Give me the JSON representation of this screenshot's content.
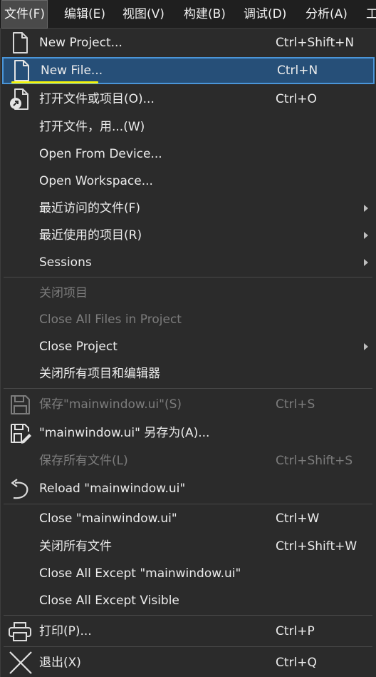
{
  "menubar": {
    "items": [
      {
        "label": "文件(F)"
      },
      {
        "label": "编辑(E)"
      },
      {
        "label": "视图(V)"
      },
      {
        "label": "构建(B)"
      },
      {
        "label": "调试(D)"
      },
      {
        "label": "分析(A)"
      },
      {
        "label": "工"
      }
    ]
  },
  "file_menu": {
    "items": {
      "new_project": {
        "label": "New Project...",
        "shortcut": "Ctrl+Shift+N",
        "icon": "new-project-icon"
      },
      "new_file": {
        "label": "New File...",
        "shortcut": "Ctrl+N",
        "icon": "new-file-icon"
      },
      "open_file_or_project": {
        "label": "打开文件或项目(O)...",
        "shortcut": "Ctrl+O",
        "icon": "open-file-icon"
      },
      "open_with": {
        "label": "打开文件，用...(W)"
      },
      "open_from_device": {
        "label": "Open From Device..."
      },
      "open_workspace": {
        "label": "Open Workspace..."
      },
      "recent_files": {
        "label": "最近访问的文件(F)"
      },
      "recent_projects": {
        "label": "最近使用的项目(R)"
      },
      "sessions": {
        "label": "Sessions"
      },
      "close_project_cn": {
        "label": "关闭项目"
      },
      "close_all_files_in_project": {
        "label": "Close All Files in Project"
      },
      "close_project": {
        "label": "Close Project"
      },
      "close_all_projects_editors": {
        "label": "关闭所有项目和编辑器"
      },
      "save": {
        "label": "保存\"mainwindow.ui\"(S)",
        "shortcut": "Ctrl+S",
        "icon": "save-icon"
      },
      "save_as": {
        "label": "\"mainwindow.ui\" 另存为(A)...",
        "icon": "save-as-icon"
      },
      "save_all": {
        "label": "保存所有文件(L)",
        "shortcut": "Ctrl+Shift+S"
      },
      "reload": {
        "label": "Reload \"mainwindow.ui\"",
        "icon": "reload-icon"
      },
      "close_file": {
        "label": "Close \"mainwindow.ui\"",
        "shortcut": "Ctrl+W"
      },
      "close_all_files": {
        "label": "关闭所有文件",
        "shortcut": "Ctrl+Shift+W"
      },
      "close_all_except": {
        "label": "Close All Except \"mainwindow.ui\""
      },
      "close_all_except_visible": {
        "label": "Close All Except Visible"
      },
      "print": {
        "label": "打印(P)...",
        "shortcut": "Ctrl+P",
        "icon": "printer-icon"
      },
      "exit": {
        "label": "退出(X)",
        "shortcut": "Ctrl+Q",
        "icon": "exit-icon"
      }
    }
  },
  "colors": {
    "menu_background": "#2b2b2b",
    "menubar_background": "#1f1f1f",
    "highlight_background": "#264f78",
    "highlight_border": "#4a95d8",
    "disabled_text": "#7c7c7c",
    "accent_underline": "#f5f50a"
  }
}
